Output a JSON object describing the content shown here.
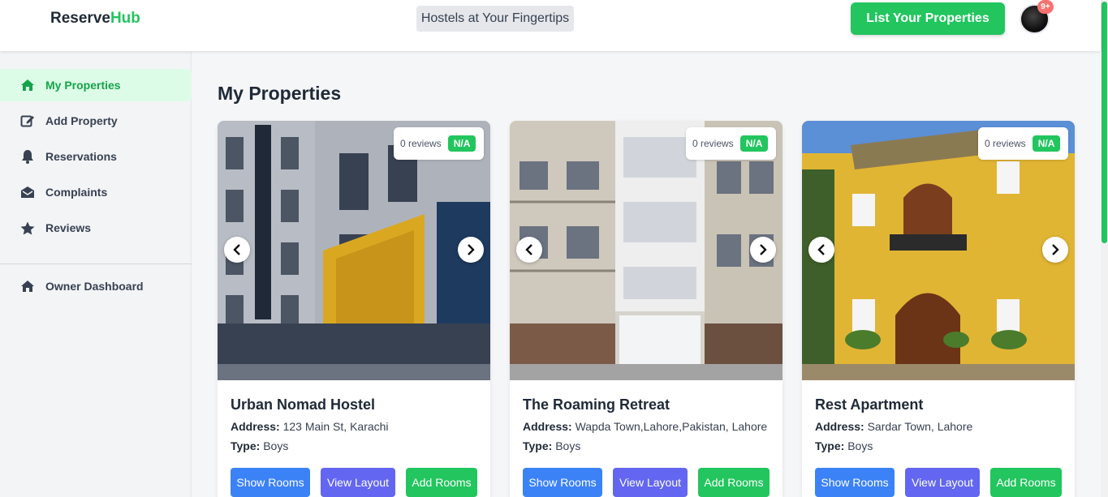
{
  "header": {
    "logo_part1": "Reserve",
    "logo_part2": "Hub",
    "tagline": "Hostels at Your Fingertips",
    "list_button": "List Your Properties",
    "notification_count": "9+"
  },
  "sidebar": {
    "items": [
      {
        "label": "My Properties",
        "icon": "home-icon",
        "active": true
      },
      {
        "label": "Add Property",
        "icon": "edit-icon",
        "active": false
      },
      {
        "label": "Reservations",
        "icon": "bell-icon",
        "active": false
      },
      {
        "label": "Complaints",
        "icon": "envelope-open-icon",
        "active": false
      },
      {
        "label": "Reviews",
        "icon": "star-icon",
        "active": false
      }
    ],
    "dashboard": {
      "label": "Owner Dashboard",
      "icon": "home-icon"
    }
  },
  "main": {
    "title": "My Properties",
    "labels": {
      "address": "Address:",
      "type": "Type:"
    },
    "buttons": {
      "show_rooms": "Show Rooms",
      "view_layout": "View Layout",
      "add_rooms": "Add Rooms"
    },
    "properties": [
      {
        "name": "Urban Nomad Hostel",
        "address": "123 Main St, Karachi",
        "type": "Boys",
        "reviews": "0 reviews",
        "rating": "N/A"
      },
      {
        "name": "The Roaming Retreat",
        "address": "Wapda Town,Lahore,Pakistan, Lahore",
        "type": "Boys",
        "reviews": "0 reviews",
        "rating": "N/A"
      },
      {
        "name": "Rest Apartment",
        "address": "Sardar Town, Lahore",
        "type": "Boys",
        "reviews": "0 reviews",
        "rating": "N/A"
      }
    ]
  },
  "colors": {
    "accent": "#22c55e",
    "blue": "#3b82f6",
    "purple": "#6366f1"
  }
}
